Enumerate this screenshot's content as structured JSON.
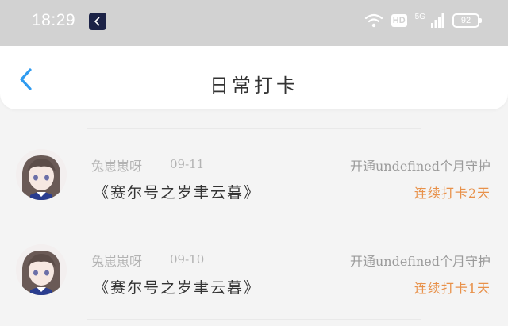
{
  "status_bar": {
    "time": "18:29",
    "hd_label": "HD",
    "signal_label": "5G",
    "battery": "92"
  },
  "header": {
    "title": "日常打卡",
    "back_icon": "chevron-left-icon"
  },
  "colors": {
    "accent": "#2f9bf0",
    "streak": "#e8914a",
    "muted": "#b3b3b3"
  },
  "records": [
    {
      "nickname": "兔崽崽呀",
      "date": "09-11",
      "guard_text": "开通undefined个月守护",
      "title": "《赛尔号之岁聿云暮》",
      "streak": "连续打卡2天"
    },
    {
      "nickname": "兔崽崽呀",
      "date": "09-10",
      "guard_text": "开通undefined个月守护",
      "title": "《赛尔号之岁聿云暮》",
      "streak": "连续打卡1天"
    }
  ]
}
